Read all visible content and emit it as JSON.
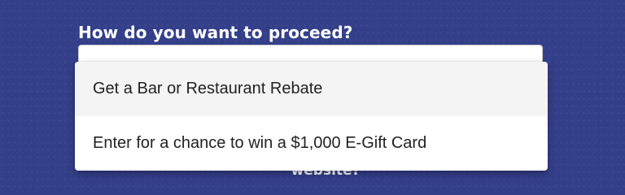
{
  "form": {
    "question": "How do you want to proceed?",
    "below_text": "website?"
  },
  "dropdown": {
    "options": [
      {
        "label": "Get a Bar or Restaurant Rebate",
        "highlighted": true
      },
      {
        "label": "Enter for a chance to win a $1,000 E-Gift Card",
        "highlighted": false
      }
    ]
  },
  "colors": {
    "background": "#343f8a",
    "option_highlight": "#f4f4f4"
  }
}
